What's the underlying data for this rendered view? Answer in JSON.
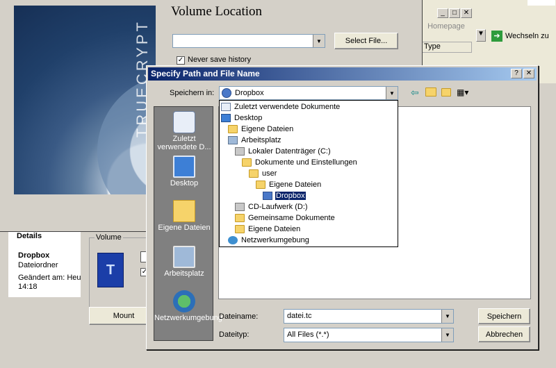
{
  "truecrypt": {
    "volume_location_title": "Volume Location",
    "select_file_label": "Select File...",
    "never_save_history_label": "Never save history",
    "never_save_history_checked": true,
    "brand_text": "TRUECRYPT",
    "volume_group_label": "Volume",
    "mount_label": "Mount"
  },
  "explorer": {
    "details_label": "Details",
    "item_name": "Dropbox",
    "item_type": "Dateiordner",
    "modified_label": "Geändert am: Heut",
    "modified_time": "14:18",
    "homepage_tab": "Homepage",
    "type_column": "Type",
    "go_label": "Wechseln zu"
  },
  "dialog": {
    "title": "Specify Path and File Name",
    "save_in_label": "Speichern in:",
    "save_in_value": "Dropbox",
    "places": [
      {
        "label": "Zuletzt verwendete D...",
        "icon": "recent-documents-icon"
      },
      {
        "label": "Desktop",
        "icon": "desktop-icon"
      },
      {
        "label": "Eigene Dateien",
        "icon": "my-documents-icon"
      },
      {
        "label": "Arbeitsplatz",
        "icon": "my-computer-icon"
      },
      {
        "label": "Netzwerkumgebung",
        "icon": "network-places-icon"
      }
    ],
    "dropdown_items": [
      {
        "label": "Zuletzt verwendete Dokumente",
        "icon": "recent-documents-icon"
      },
      {
        "label": "Desktop",
        "icon": "desktop-icon"
      },
      {
        "label": "Eigene Dateien",
        "icon": "folder-icon"
      },
      {
        "label": "Arbeitsplatz",
        "icon": "my-computer-icon"
      },
      {
        "label": "Lokaler Datenträger (C:)",
        "icon": "drive-icon"
      },
      {
        "label": "Dokumente und Einstellungen",
        "icon": "folder-icon"
      },
      {
        "label": "user",
        "icon": "folder-icon"
      },
      {
        "label": "Eigene Dateien",
        "icon": "folder-icon"
      },
      {
        "label": "Dropbox",
        "icon": "dropbox-folder-icon"
      },
      {
        "label": "CD-Laufwerk (D:)",
        "icon": "cd-drive-icon"
      },
      {
        "label": "Gemeinsame Dokumente",
        "icon": "folder-icon"
      },
      {
        "label": "Eigene Dateien",
        "icon": "folder-icon"
      },
      {
        "label": "Netzwerkumgebung",
        "icon": "network-icon"
      }
    ],
    "selected_index": 8,
    "filename_label": "Dateiname:",
    "filename_value": "datei.tc",
    "filetype_label": "Dateityp:",
    "filetype_value": "All Files (*.*)",
    "save_label": "Speichern",
    "cancel_label": "Abbrechen",
    "help_glyph": "?",
    "close_glyph": "✕"
  },
  "colors": {
    "title_gradient_start": "#0a246a",
    "title_gradient_end": "#a6caf0",
    "selection": "#0a246a",
    "places_bar": "#808080",
    "dialog_bg": "#d4d0c8"
  }
}
